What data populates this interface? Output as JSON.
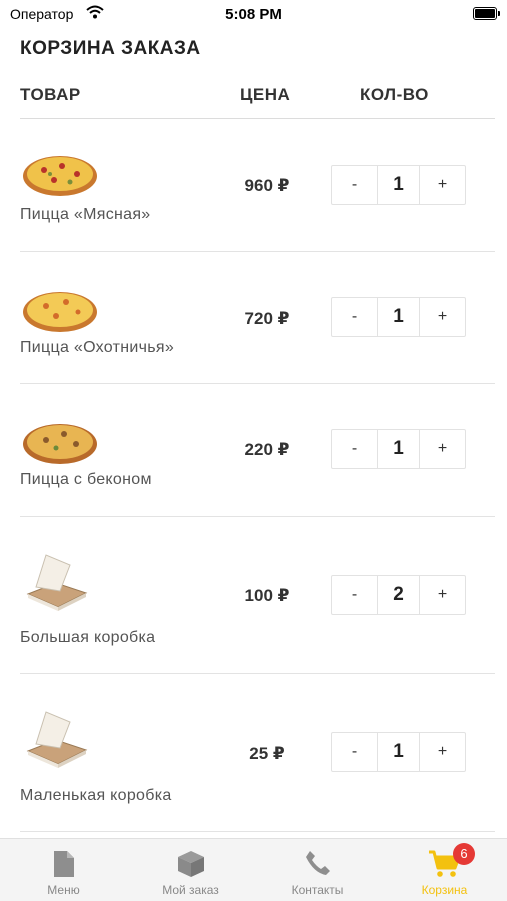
{
  "status": {
    "carrier": "Оператор",
    "time": "5:08 PM"
  },
  "page": {
    "title": "КОРЗИНА ЗАКАЗА"
  },
  "columns": {
    "product": "ТОВАР",
    "price": "ЦЕНА",
    "qty": "КОЛ-ВО"
  },
  "items": [
    {
      "name": "Пицца «Мясная»",
      "price": "960 ₽",
      "qty": "1",
      "minus": "-",
      "plus": "+",
      "image": "pizza-meat"
    },
    {
      "name": "Пицца «Охотничья»",
      "price": "720 ₽",
      "qty": "1",
      "minus": "-",
      "plus": "+",
      "image": "pizza-hunter"
    },
    {
      "name": "Пицца с беконом",
      "price": "220 ₽",
      "qty": "1",
      "minus": "-",
      "plus": "+",
      "image": "pizza-bacon"
    },
    {
      "name": "Большая коробка",
      "price": "100 ₽",
      "qty": "2",
      "minus": "-",
      "plus": "+",
      "image": "pizza-box"
    },
    {
      "name": "Маленькая коробка",
      "price": "25 ₽",
      "qty": "1",
      "minus": "-",
      "plus": "+",
      "image": "pizza-box"
    }
  ],
  "tabs": [
    {
      "label": "Меню",
      "icon": "document-icon"
    },
    {
      "label": "Мой заказ",
      "icon": "box-icon"
    },
    {
      "label": "Контакты",
      "icon": "phone-icon"
    },
    {
      "label": "Корзина",
      "icon": "cart-icon",
      "badge": "6",
      "active": true
    }
  ],
  "colors": {
    "accent": "#f3c10f",
    "badge": "#e53935",
    "inactive": "#888888"
  }
}
